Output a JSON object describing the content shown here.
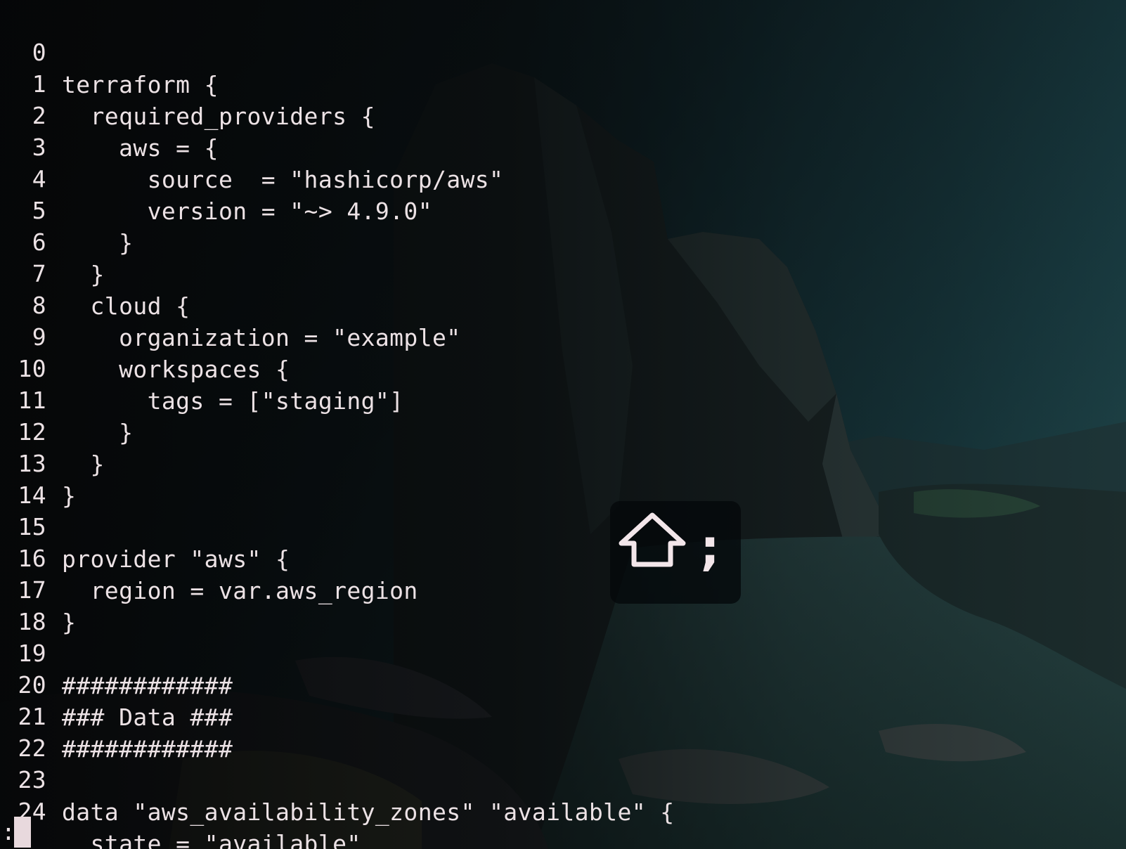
{
  "editor": {
    "lines": [
      {
        "num": "0",
        "text": "terraform {"
      },
      {
        "num": "1",
        "text": "  required_providers {"
      },
      {
        "num": "2",
        "text": "    aws = {"
      },
      {
        "num": "3",
        "text": "      source  = \"hashicorp/aws\""
      },
      {
        "num": "4",
        "text": "      version = \"~> 4.9.0\""
      },
      {
        "num": "5",
        "text": "    }"
      },
      {
        "num": "6",
        "text": "  }"
      },
      {
        "num": "7",
        "text": "  cloud {"
      },
      {
        "num": "8",
        "text": "    organization = \"example\""
      },
      {
        "num": "9",
        "text": "    workspaces {"
      },
      {
        "num": "10",
        "text": "      tags = [\"staging\"]"
      },
      {
        "num": "11",
        "text": "    }"
      },
      {
        "num": "12",
        "text": "  }"
      },
      {
        "num": "13",
        "text": "}"
      },
      {
        "num": "14",
        "text": ""
      },
      {
        "num": "15",
        "text": "provider \"aws\" {"
      },
      {
        "num": "16",
        "text": "  region = var.aws_region"
      },
      {
        "num": "17",
        "text": "}"
      },
      {
        "num": "18",
        "text": ""
      },
      {
        "num": "19",
        "text": "############"
      },
      {
        "num": "20",
        "text": "### Data ###"
      },
      {
        "num": "21",
        "text": "############"
      },
      {
        "num": "22",
        "text": ""
      },
      {
        "num": "23",
        "text": "data \"aws_availability_zones\" \"available\" {"
      },
      {
        "num": "24",
        "text": "  state = \"available\""
      }
    ]
  },
  "command_line": {
    "prompt": ":"
  },
  "key_overlay": {
    "modifier_icon": "shift-arrow-icon",
    "key": ";"
  },
  "colors": {
    "text": "#ece2e5",
    "cursor": "#e8d9dd",
    "overlay_background": "#04080a"
  }
}
